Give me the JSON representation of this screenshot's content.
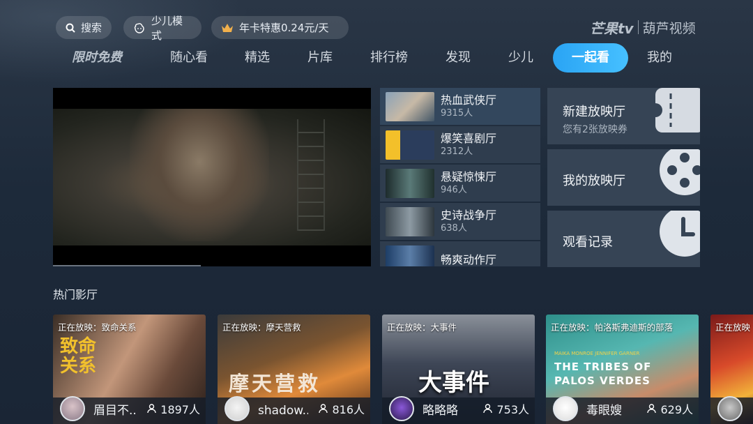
{
  "topbar": {
    "search_label": "搜索",
    "kids_mode_label": "少儿模式",
    "vip_label": "年卡特惠0.24元/天",
    "brand_left": "芒果tv",
    "brand_right": "葫芦视频"
  },
  "nav": {
    "promo": "限时免费",
    "items": [
      "随心看",
      "精选",
      "片库",
      "排行榜",
      "发现",
      "少儿",
      "一起看",
      "我的"
    ],
    "active": "一起看"
  },
  "halls": [
    {
      "name": "热血武侠厅",
      "count": "9315人",
      "selected": true
    },
    {
      "name": "爆笑喜剧厅",
      "count": "2312人"
    },
    {
      "name": "悬疑惊悚厅",
      "count": "946人"
    },
    {
      "name": "史诗战争厅",
      "count": "638人"
    },
    {
      "name": "畅爽动作厅",
      "count": ""
    }
  ],
  "actions": {
    "new_room_title": "新建放映厅",
    "new_room_sub": "您有2张放映券",
    "my_room_title": "我的放映厅",
    "history_title": "观看记录"
  },
  "section": {
    "title": "热门影厅"
  },
  "cards": [
    {
      "now_playing": "正在放映：致命关系",
      "poster_text": "致命\n关系",
      "host": "眉目不..",
      "viewers": "1897人"
    },
    {
      "now_playing": "正在放映：摩天营救",
      "poster_text": "摩天营救",
      "host": "shadow..",
      "viewers": "816人"
    },
    {
      "now_playing": "正在放映：大事件",
      "poster_text": "大事件",
      "host": "略略略",
      "viewers": "753人"
    },
    {
      "now_playing": "正在放映：帕洛斯弗迪斯的部落",
      "poster_small": "MAIKA MONROE  JENNIFER GARNER",
      "poster_text_l1": "THE TRIBES OF",
      "poster_text_l2": "PALOS VERDES",
      "host": "毒眼嫂",
      "viewers": "629人"
    },
    {
      "now_playing": "正在放映",
      "host": ""
    }
  ],
  "colors": {
    "accent": "#2aa4f4",
    "background": "#1d2a3a"
  }
}
